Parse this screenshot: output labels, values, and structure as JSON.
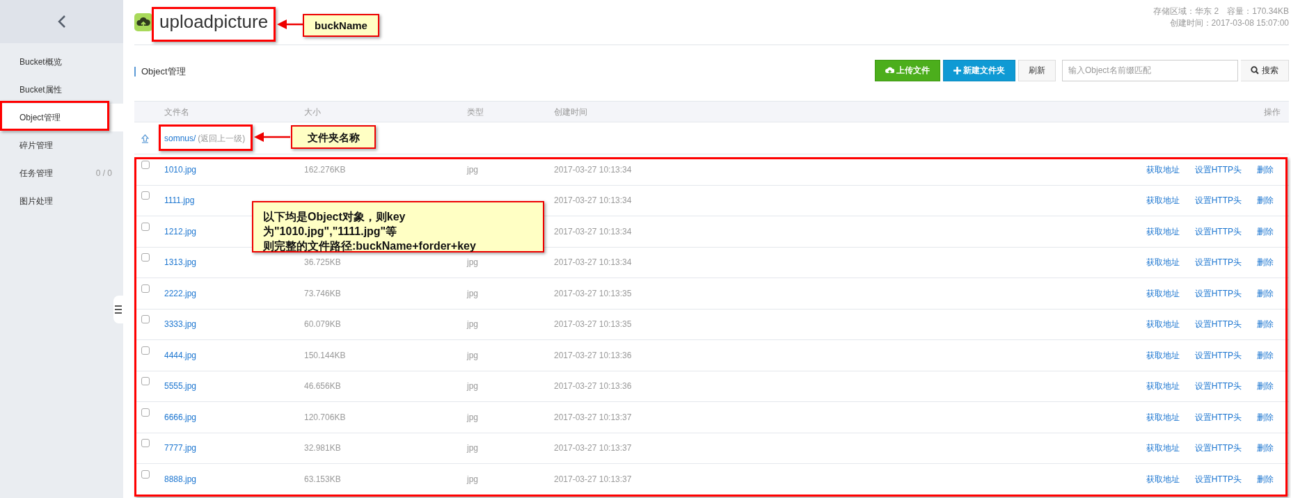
{
  "sidebar": {
    "items": [
      {
        "label": "Bucket概览",
        "selected": false
      },
      {
        "label": "Bucket属性",
        "selected": false
      },
      {
        "label": "Object管理",
        "selected": true
      },
      {
        "label": "碎片管理",
        "selected": false
      },
      {
        "label": "任务管理",
        "count": "0 / 0",
        "selected": false
      },
      {
        "label": "图片处理",
        "selected": false
      }
    ]
  },
  "header": {
    "bucket_name": "uploadpicture",
    "meta": [
      [
        "存储区域：华东 2",
        "容量：170.34KB"
      ],
      [
        "创建时间：2017-03-08 15:07:00"
      ]
    ]
  },
  "section_title": "Object管理",
  "toolbar": {
    "upload": "上传文件",
    "new_folder": "新建文件夹",
    "refresh": "刷新",
    "search": {
      "placeholder": "输入Object名前缀匹配"
    },
    "search_button": "搜索"
  },
  "table": {
    "columns": [
      "文件名",
      "大小",
      "类型",
      "创建时间",
      "操作"
    ],
    "folder": {
      "name": "somnus/",
      "back": "(返回上一级)"
    },
    "rows": [
      {
        "name": "1010.jpg",
        "size": "162.276KB",
        "type": "jpg",
        "created": "2017-03-27 10:13:34",
        "checked": false,
        "actions": [
          "获取地址",
          "设置HTTP头",
          "删除"
        ]
      },
      {
        "name": "1111.jpg",
        "created": "2017-03-27 10:13:34",
        "checked": false,
        "actions": [
          "获取地址",
          "设置HTTP头",
          "删除"
        ]
      },
      {
        "name": "1212.jpg",
        "created": "2017-03-27 10:13:34",
        "checked": false,
        "actions": [
          "获取地址",
          "设置HTTP头",
          "删除"
        ]
      },
      {
        "name": "1313.jpg",
        "size": "36.725KB",
        "type": "jpg",
        "created": "2017-03-27 10:13:34",
        "checked": false,
        "actions": [
          "获取地址",
          "设置HTTP头",
          "删除"
        ]
      },
      {
        "name": "2222.jpg",
        "size": "73.746KB",
        "type": "jpg",
        "created": "2017-03-27 10:13:35",
        "checked": false,
        "actions": [
          "获取地址",
          "设置HTTP头",
          "删除"
        ]
      },
      {
        "name": "3333.jpg",
        "size": "60.079KB",
        "type": "jpg",
        "created": "2017-03-27 10:13:35",
        "checked": false,
        "actions": [
          "获取地址",
          "设置HTTP头",
          "删除"
        ]
      },
      {
        "name": "4444.jpg",
        "size": "150.144KB",
        "type": "jpg",
        "created": "2017-03-27 10:13:36",
        "checked": false,
        "actions": [
          "获取地址",
          "设置HTTP头",
          "删除"
        ]
      },
      {
        "name": "5555.jpg",
        "size": "46.656KB",
        "type": "jpg",
        "created": "2017-03-27 10:13:36",
        "checked": false,
        "actions": [
          "获取地址",
          "设置HTTP头",
          "删除"
        ]
      },
      {
        "name": "6666.jpg",
        "size": "120.706KB",
        "type": "jpg",
        "created": "2017-03-27 10:13:37",
        "checked": false,
        "actions": [
          "获取地址",
          "设置HTTP头",
          "删除"
        ]
      },
      {
        "name": "7777.jpg",
        "size": "32.981KB",
        "type": "jpg",
        "created": "2017-03-27 10:13:37",
        "checked": false,
        "actions": [
          "获取地址",
          "设置HTTP头",
          "删除"
        ]
      },
      {
        "name": "8888.jpg",
        "size": "63.153KB",
        "type": "jpg",
        "created": "2017-03-27 10:13:37",
        "checked": false,
        "actions": [
          "获取地址",
          "设置HTTP头",
          "删除"
        ]
      }
    ]
  },
  "annotations": [
    {
      "kind": "frame"
    },
    {
      "kind": "arrow"
    },
    {
      "kind": "callout",
      "lines": [
        "buckName"
      ]
    },
    {
      "kind": "frame"
    },
    {
      "kind": "frame"
    },
    {
      "kind": "arrow"
    },
    {
      "kind": "callout",
      "lines": [
        "文件夹名称"
      ]
    },
    {
      "kind": "frame"
    },
    {
      "kind": "callout",
      "lines": [
        "以下均是Object对象，则key为\"1010.jpg\",\"1111.jpg\"等",
        "则完整的文件路径:buckName+forder+key"
      ]
    }
  ]
}
